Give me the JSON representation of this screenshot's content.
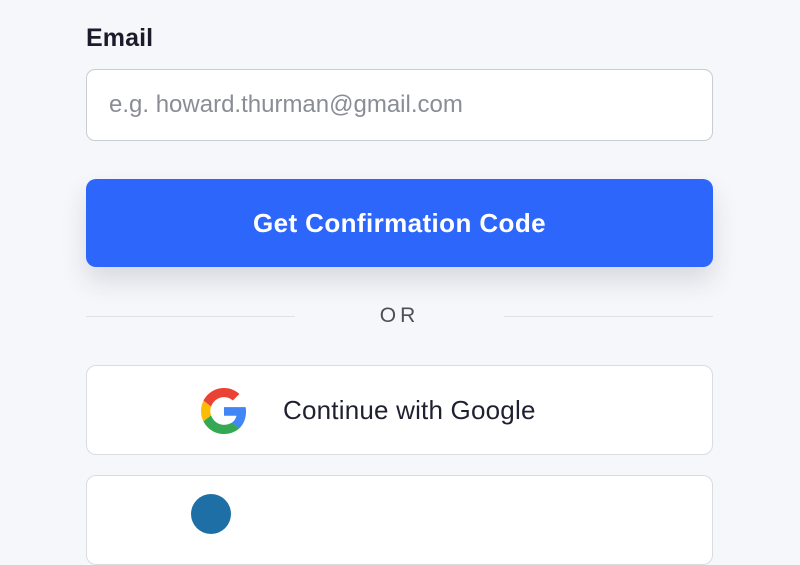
{
  "form": {
    "email_label": "Email",
    "email_placeholder": "e.g. howard.thurman@gmail.com",
    "email_value": "",
    "submit_label": "Get Confirmation Code",
    "divider_text": "OR",
    "google_label": "Continue with Google"
  },
  "icons": {
    "google": "google-g-icon",
    "second_provider": "provider-icon"
  },
  "colors": {
    "background": "#f6f7fa",
    "primary": "#2d66fb",
    "text": "#1a1c2c",
    "google_red": "#EA4335",
    "google_yellow": "#FBBC05",
    "google_green": "#34A853",
    "google_blue": "#4285F4"
  }
}
